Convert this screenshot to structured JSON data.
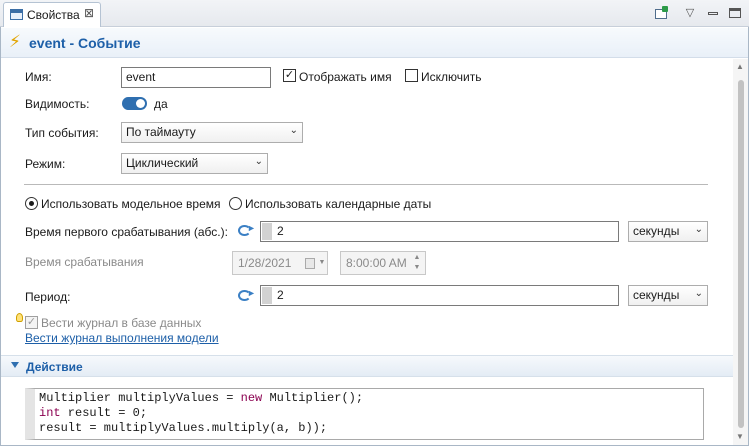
{
  "tab": {
    "label": "Свойства",
    "close": "⊠"
  },
  "header": {
    "title": "event - Событие"
  },
  "form": {
    "name_label": "Имя:",
    "name_value": "event",
    "show_name_label": "Отображать имя",
    "show_name_checked": true,
    "exclude_label": "Исключить",
    "exclude_checked": false,
    "visibility_label": "Видимость:",
    "visibility_value": "да",
    "event_type_label": "Тип события:",
    "event_type_value": "По таймауту",
    "mode_label": "Режим:",
    "mode_value": "Циклический",
    "radio_model_time": "Использовать модельное время",
    "radio_calendar": "Использовать календарные даты",
    "first_trigger_label": "Время первого срабатывания (абс.):",
    "first_trigger_value": "2",
    "first_trigger_unit": "секунды",
    "trigger_time_label": "Время срабатывания",
    "trigger_date": "1/28/2021",
    "trigger_clock": "8:00:00 AM",
    "period_label": "Период:",
    "period_value": "2",
    "period_unit": "секунды",
    "log_db_label": "Вести журнал в базе данных",
    "log_link": "Вести журнал выполнения модели"
  },
  "action": {
    "title": "Действие",
    "code": {
      "line1_a": "Multiplier multiplyValues = ",
      "line1_kw": "new",
      "line1_b": " Multiplier();",
      "line2_kw": "int",
      "line2_b": " result = 0;",
      "line3": "result = multiplyValues.multiply(a, b));"
    }
  },
  "colors": {
    "accent": "#1d5fa8",
    "toggle": "#2f6fb0",
    "keyword": "#8b0050",
    "bolt": "#e2a400"
  },
  "icons": [
    "properties-icon",
    "close-icon",
    "pin-icon",
    "view-menu-icon",
    "minimize-icon",
    "maximize-icon",
    "bolt-icon",
    "dynamic-value-icon",
    "calendar-icon",
    "lightbulb-icon",
    "collapse-arrow-icon"
  ]
}
